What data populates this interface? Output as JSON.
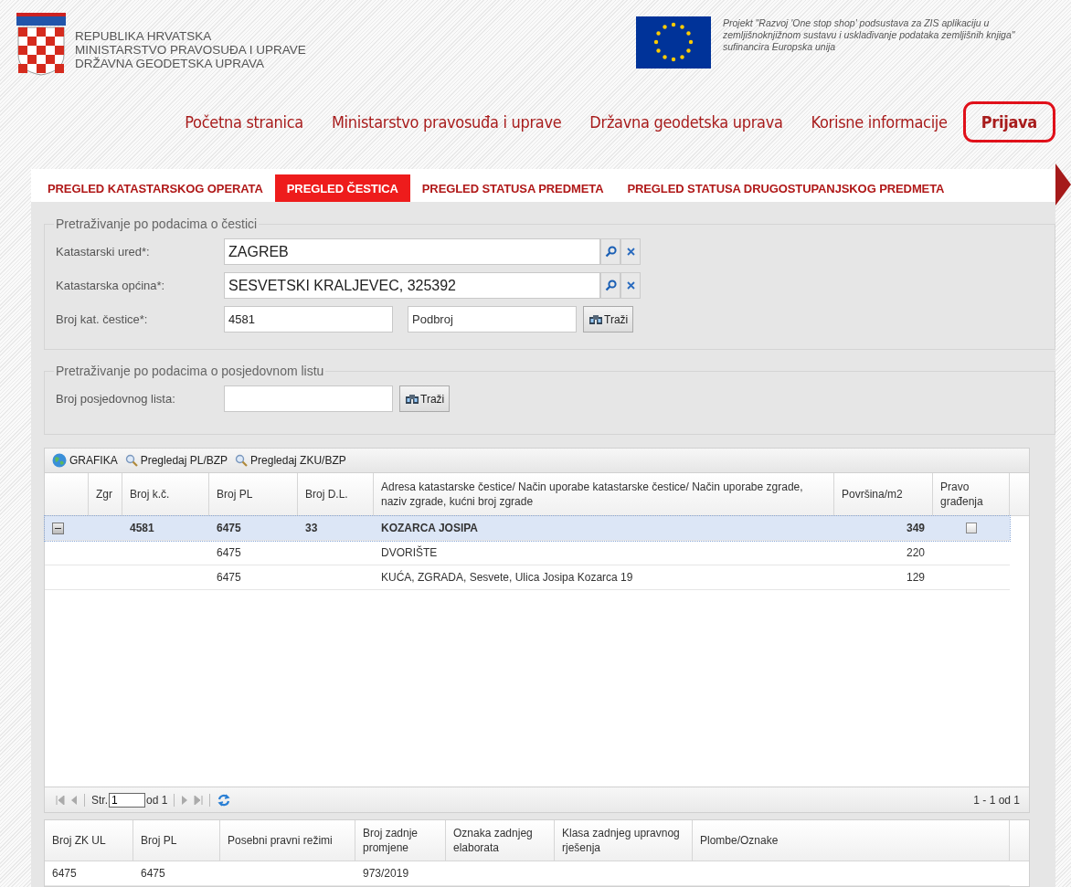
{
  "header": {
    "org_lines": [
      "REPUBLIKA HRVATSKA",
      "MINISTARSTVO PRAVOSUĐA I UPRAVE",
      "DRŽAVNA GEODETSKA UPRAVA"
    ],
    "project_lines": [
      "Projekt \"Razvoj 'One stop shop' podsustava za ZIS aplikaciju u",
      "zemljišnoknjižnom sustavu i usklađivanje podataka zemljišnih knjiga\"",
      "sufinancira Europska unija"
    ]
  },
  "nav": [
    {
      "label": "Početna stranica",
      "kind": "link"
    },
    {
      "label": "Ministarstvo pravosuđa i uprave",
      "kind": "link"
    },
    {
      "label": "Državna geodetska uprava",
      "kind": "link"
    },
    {
      "label": "Korisne informacije",
      "kind": "link"
    },
    {
      "label": "Prijava",
      "kind": "login"
    }
  ],
  "tabs": [
    {
      "label": "PREGLED KATASTARSKOG OPERATA",
      "selected": false
    },
    {
      "label": "PREGLED ČESTICA",
      "selected": true
    },
    {
      "label": "PREGLED STATUSA PREDMETA",
      "selected": false
    },
    {
      "label": "PREGLED STATUSA DRUGOSTUPANJSKOG PREDMETA",
      "selected": false
    }
  ],
  "parcel_search": {
    "legend": "Pretraživanje po podacima o čestici",
    "fields": [
      {
        "kind": "lookup",
        "label": "Katastarski ured*:",
        "value": "ZAGREB"
      },
      {
        "kind": "lookup",
        "label": "Katastarska općina*:",
        "value": "SESVETSKI KRALJEVEC, 325392"
      },
      {
        "kind": "number",
        "label": "Broj kat. čestice*:",
        "value": "4581",
        "placeholder": "Podbroj",
        "button": "Traži"
      }
    ]
  },
  "holding_search": {
    "legend": "Pretraživanje po podacima o posjedovnom listu",
    "label": "Broj posjedovnog lista:",
    "button": "Traži"
  },
  "grid": {
    "toolbar": [
      {
        "kind": "globe",
        "label": "GRAFIKA"
      },
      {
        "kind": "search",
        "label": "Pregledaj PL/BZP"
      },
      {
        "kind": "search",
        "label": "Pregledaj ZKU/BZP"
      }
    ],
    "columns": [
      "Zgr",
      "Broj k.č.",
      "Broj PL",
      "Broj D.L.",
      "Adresa katastarske čestice/ Način uporabe katastarske čestice/ Način uporabe zgrade, naziv zgrade, kućni broj zgrade",
      "Površina/m2",
      "Pravo građenja"
    ],
    "rows": [
      {
        "selected": true,
        "expanded": true,
        "checked": false,
        "cells": [
          null,
          "4581",
          "6475",
          "33",
          "KOZARCA JOSIPA",
          "349"
        ],
        "children": [
          {
            "cells": [
              null,
              null,
              "6475",
              null,
              "DVORIŠTE",
              "220"
            ]
          },
          {
            "cells": [
              null,
              null,
              "6475",
              null,
              "KUĆA, ZGRADA, Sesvete, Ulica Josipa Kozarca 19",
              "129"
            ]
          }
        ]
      }
    ],
    "pager": {
      "page_label": "Str.",
      "page": "1",
      "total": "od 1",
      "summary": "1 - 1 od 1"
    }
  },
  "details": {
    "columns": [
      "Broj ZK UL",
      "Broj PL",
      "Posebni pravni režimi",
      "Broj zadnje promjene",
      "Oznaka zadnjeg elaborata",
      "Klasa zadnjeg upravnog rješenja",
      "Plombe/Oznake"
    ],
    "rows": [
      [
        "6475",
        "6475",
        null,
        "973/2019",
        null,
        null,
        null
      ]
    ]
  }
}
